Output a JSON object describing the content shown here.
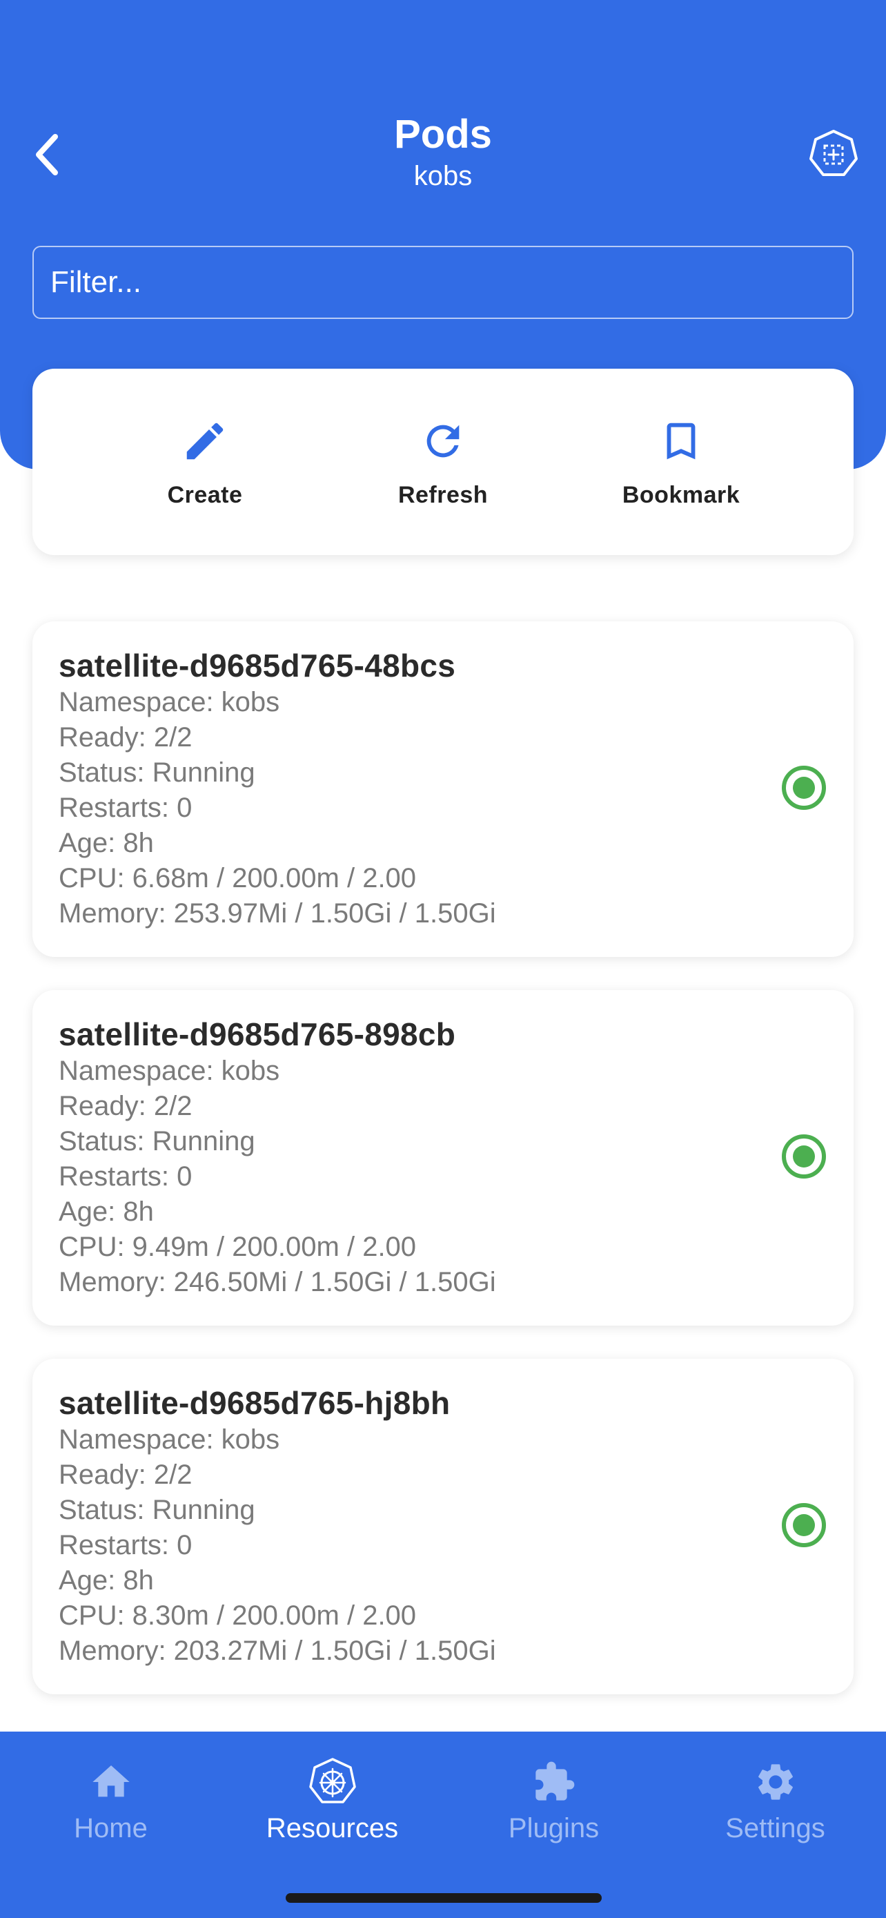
{
  "header": {
    "title": "Pods",
    "subtitle": "kobs",
    "back_icon": "chevron-left-icon",
    "resource_icon": "kubernetes-pod-icon"
  },
  "filter": {
    "placeholder": "Filter...",
    "value": ""
  },
  "actions": [
    {
      "label": "Create",
      "icon": "pencil-icon"
    },
    {
      "label": "Refresh",
      "icon": "refresh-icon"
    },
    {
      "label": "Bookmark",
      "icon": "bookmark-icon"
    }
  ],
  "pods": [
    {
      "name": "satellite-d9685d765-48bcs",
      "namespace": "Namespace: kobs",
      "ready": "Ready: 2/2",
      "status": "Status: Running",
      "restarts": "Restarts: 0",
      "age": "Age: 8h",
      "cpu": "CPU: 6.68m / 200.00m / 2.00",
      "memory": "Memory: 253.97Mi / 1.50Gi / 1.50Gi",
      "status_color": "#4caf50"
    },
    {
      "name": "satellite-d9685d765-898cb",
      "namespace": "Namespace: kobs",
      "ready": "Ready: 2/2",
      "status": "Status: Running",
      "restarts": "Restarts: 0",
      "age": "Age: 8h",
      "cpu": "CPU: 9.49m / 200.00m / 2.00",
      "memory": "Memory: 246.50Mi / 1.50Gi / 1.50Gi",
      "status_color": "#4caf50"
    },
    {
      "name": "satellite-d9685d765-hj8bh",
      "namespace": "Namespace: kobs",
      "ready": "Ready: 2/2",
      "status": "Status: Running",
      "restarts": "Restarts: 0",
      "age": "Age: 8h",
      "cpu": "CPU: 8.30m / 200.00m / 2.00",
      "memory": "Memory: 203.27Mi / 1.50Gi / 1.50Gi",
      "status_color": "#4caf50"
    }
  ],
  "tabs": [
    {
      "label": "Home",
      "icon": "home-icon",
      "active": false
    },
    {
      "label": "Resources",
      "icon": "kubernetes-helm-icon",
      "active": true
    },
    {
      "label": "Plugins",
      "icon": "puzzle-icon",
      "active": false
    },
    {
      "label": "Settings",
      "icon": "gear-icon",
      "active": false
    }
  ],
  "colors": {
    "primary": "#326ce5",
    "status_ok": "#4caf50",
    "tab_inactive": "#9fbcf5"
  }
}
